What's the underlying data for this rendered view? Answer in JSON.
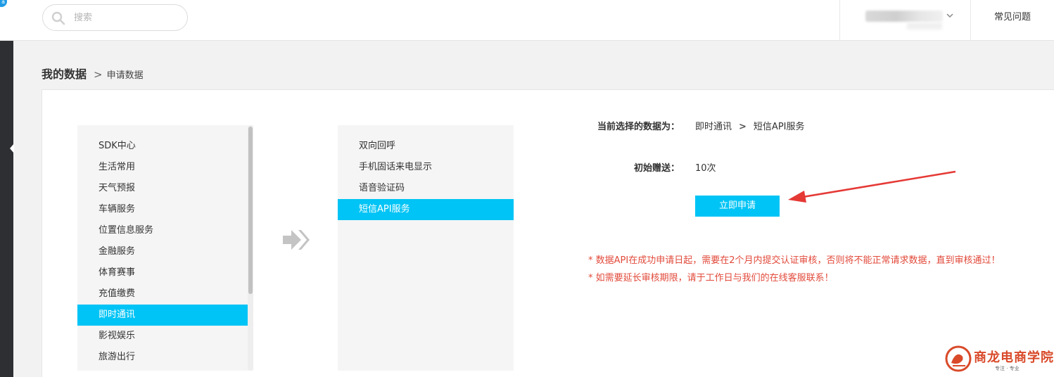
{
  "header": {
    "badge_text": "a",
    "search_placeholder": "搜索",
    "faq_label": "常见问题"
  },
  "breadcrumb": {
    "main": "我的数据",
    "separator": ">",
    "current": "申请数据"
  },
  "categories": {
    "items": [
      {
        "label": "SDK中心"
      },
      {
        "label": "生活常用"
      },
      {
        "label": "天气预报"
      },
      {
        "label": "车辆服务"
      },
      {
        "label": "位置信息服务"
      },
      {
        "label": "金融服务"
      },
      {
        "label": "体育赛事"
      },
      {
        "label": "充值缴费"
      },
      {
        "label": "即时通讯",
        "active": true
      },
      {
        "label": "影视娱乐"
      },
      {
        "label": "旅游出行"
      }
    ]
  },
  "subcategories": {
    "items": [
      {
        "label": "双向回呼"
      },
      {
        "label": "手机固话来电显示"
      },
      {
        "label": "语音验证码"
      },
      {
        "label": "短信API服务",
        "active": true
      }
    ]
  },
  "selection": {
    "label": "当前选择的数据为：",
    "category": "即时通讯",
    "separator": ">",
    "service": "短信API服务"
  },
  "gift": {
    "label": "初始赠送：",
    "value": "10次"
  },
  "apply_button": "立即申请",
  "notes": [
    "* 数据API在成功申请日起，需要在2个月内提交认证审核，否则将不能正常请求数据，直到审核通过！",
    "* 如需要延长审核期限，请于工作日与我们的在线客服联系！"
  ],
  "watermark": {
    "name": "商龙电商学院",
    "tagline": "专注 · 专业"
  },
  "colors": {
    "accent": "#00c4f5",
    "warning": "#e24a3b",
    "rail": "#2d2f33"
  }
}
